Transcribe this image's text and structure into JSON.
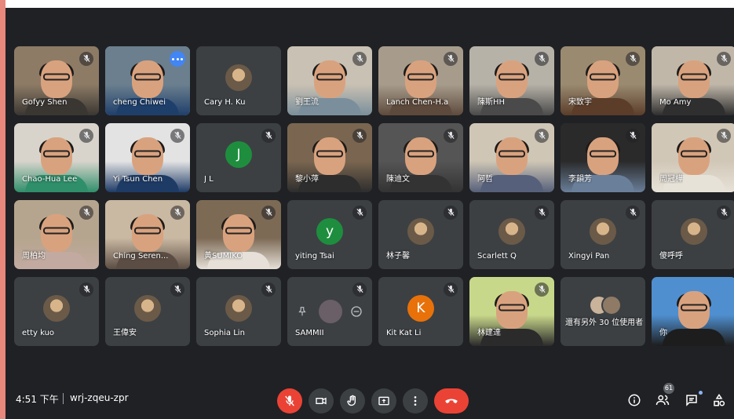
{
  "colors": {
    "accent_red": "#ea4335",
    "tile_bg": "#3c4043",
    "bg": "#202124",
    "active_border": "#8ab4f8"
  },
  "tiles": [
    {
      "name": "Gofyy Shen",
      "type": "video",
      "muted": true
    },
    {
      "name": "cheng Chiwei",
      "type": "video",
      "muted": false,
      "active": true,
      "more_options": true
    },
    {
      "name": "Cary H. Ku",
      "type": "avatar-photo",
      "muted": false
    },
    {
      "name": "劉王流",
      "type": "video",
      "muted": true
    },
    {
      "name": "Lanch Chen-H.a",
      "type": "video",
      "muted": true
    },
    {
      "name": "陳斯HH",
      "type": "video",
      "muted": true
    },
    {
      "name": "宋致宇",
      "type": "video",
      "muted": true
    },
    {
      "name": "Mo Amy",
      "type": "video",
      "muted": true
    },
    {
      "name": "Chao-Hua Lee",
      "type": "video",
      "muted": true
    },
    {
      "name": "Yi Tsun Chen",
      "type": "video",
      "muted": true
    },
    {
      "name": "J L",
      "type": "letter",
      "letter": "J",
      "avatar_color": "#1e8e3e",
      "muted": true
    },
    {
      "name": "黎小萍",
      "type": "video",
      "muted": true
    },
    {
      "name": "陳迪文",
      "type": "video",
      "muted": true
    },
    {
      "name": "阿哲",
      "type": "video",
      "muted": true
    },
    {
      "name": "李韻芳",
      "type": "video",
      "muted": true
    },
    {
      "name": "周冠樺",
      "type": "video",
      "muted": true
    },
    {
      "name": "周柏均",
      "type": "video",
      "muted": true
    },
    {
      "name": "Ching Seren...",
      "type": "video",
      "muted": true
    },
    {
      "name": "黃SUMIKO",
      "type": "video",
      "muted": true
    },
    {
      "name": "yiting Tsai",
      "type": "letter",
      "letter": "y",
      "avatar_color": "#1e8e3e",
      "muted": true
    },
    {
      "name": "林子馨",
      "type": "avatar-photo",
      "muted": true
    },
    {
      "name": "Scarlett Q",
      "type": "avatar-photo",
      "muted": true
    },
    {
      "name": "Xingyi Pan",
      "type": "avatar-photo",
      "muted": true
    },
    {
      "name": "傻呼呼",
      "type": "avatar-photo",
      "muted": true
    },
    {
      "name": "etty kuo",
      "type": "avatar-photo",
      "muted": true
    },
    {
      "name": "王偉安",
      "type": "avatar-photo",
      "muted": true
    },
    {
      "name": "Sophia Lin",
      "type": "avatar-photo",
      "muted": true
    },
    {
      "name": "SAMMII",
      "type": "pinned-controls",
      "muted": true
    },
    {
      "name": "Kit Kat Li",
      "type": "letter",
      "letter": "K",
      "avatar_color": "#e8710a",
      "muted": true
    },
    {
      "name": "林建達",
      "type": "video",
      "muted": true
    },
    {
      "name": "還有另外 30 位使用者",
      "type": "others",
      "muted": false
    },
    {
      "name": "你",
      "type": "video",
      "muted": false
    }
  ],
  "bottom": {
    "time": "4:51 下午",
    "meeting_code": "wrj-zqeu-zpr",
    "participant_count": "61",
    "icons": [
      "mic-off-icon",
      "camera-icon",
      "raise-hand-icon",
      "present-icon",
      "more-icon",
      "end-call-icon",
      "info-icon",
      "people-icon",
      "chat-icon",
      "activities-icon"
    ]
  }
}
